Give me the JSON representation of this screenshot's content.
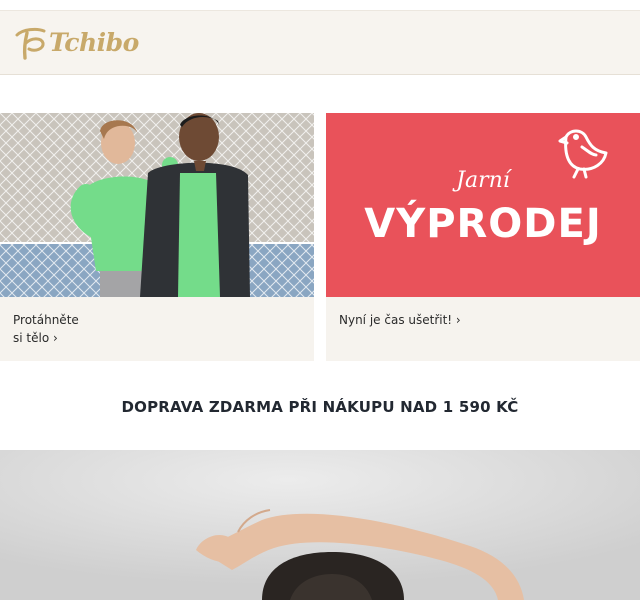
{
  "brand": {
    "name": "Tchibo",
    "color": "#c8a96a"
  },
  "teasers": [
    {
      "caption_line1": "Protáhněte",
      "caption_line2": "si tělo ›"
    },
    {
      "label_script": "Jarní",
      "label_title": "VÝPRODEJ",
      "background": "#e9525a",
      "caption_line1": "Nyní je čas ušetřit! ›"
    }
  ],
  "shipping_banner": {
    "text": "DOPRAVA ZDARMA PŘI NÁKUPU NAD 1 590 KČ"
  },
  "icons": {
    "brand_mark": "tchibo-logo-icon",
    "sale_bird": "bird-icon"
  }
}
